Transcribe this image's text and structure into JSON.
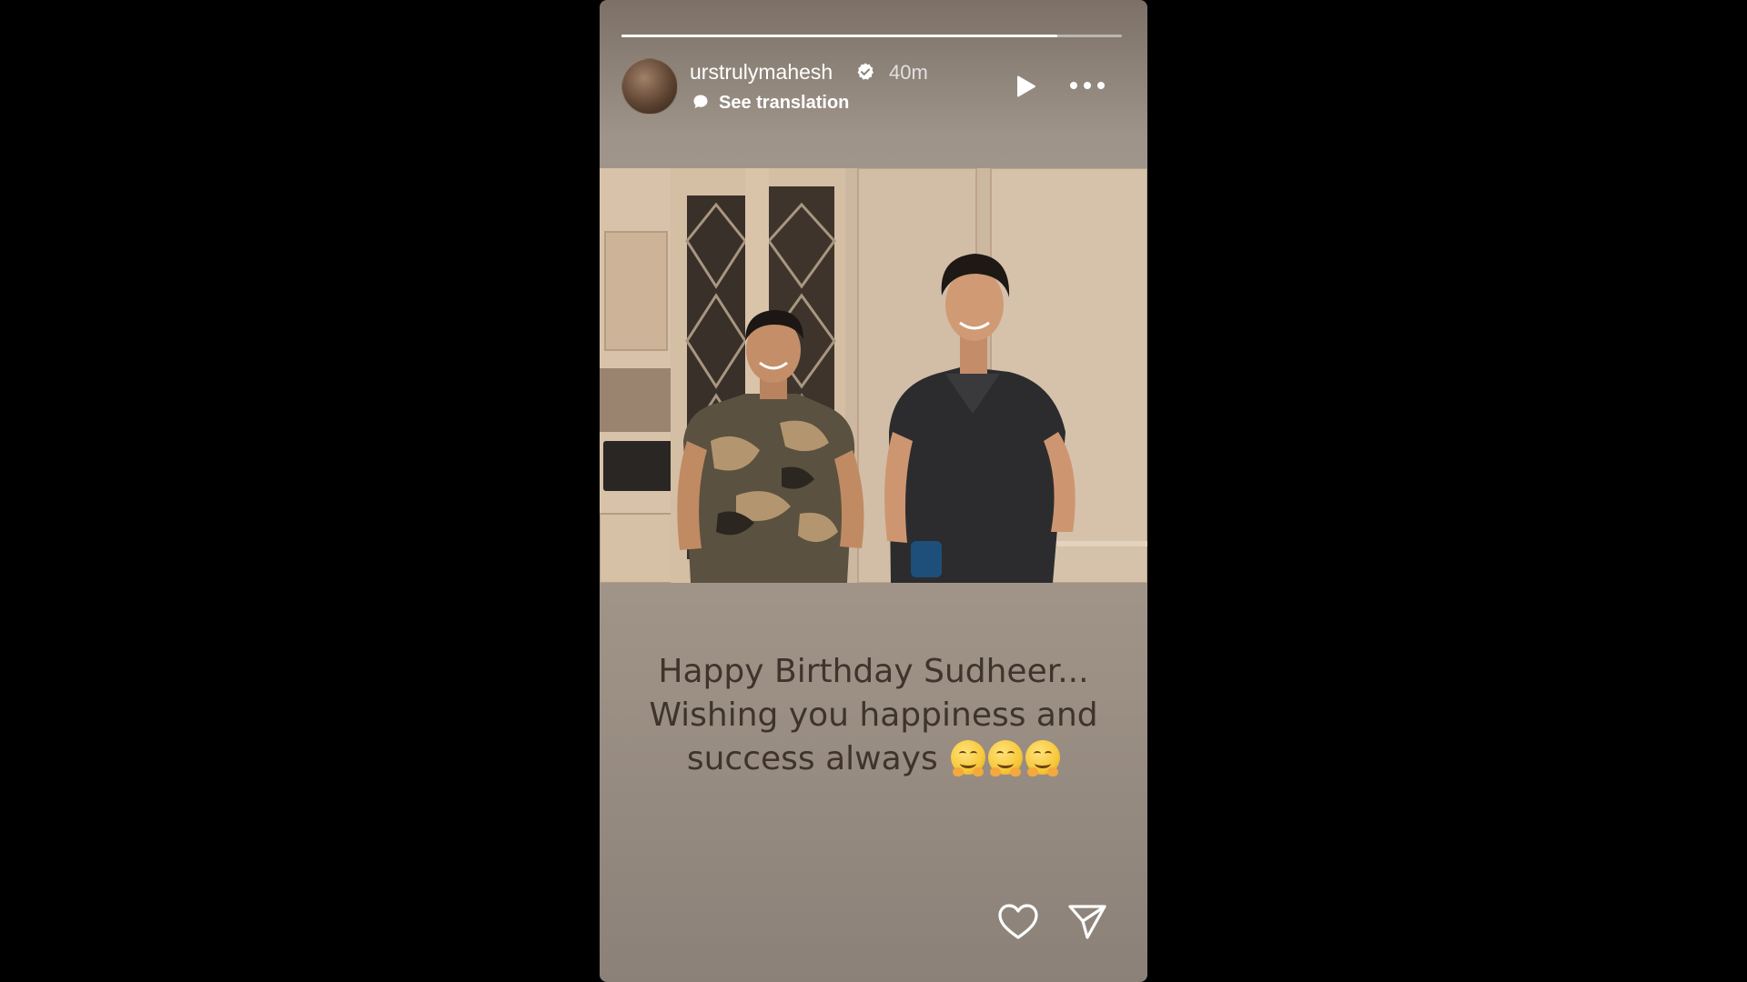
{
  "story": {
    "username": "urstrulymahesh",
    "time_ago": "40m",
    "translation_label": "See translation",
    "progress": 0.87,
    "caption": {
      "line1": "Happy Birthday Sudheer...",
      "line2": "Wishing you happiness and",
      "line3": "success always",
      "emoji_count": 3,
      "emoji_name": "smiling-face-with-open-hands"
    }
  },
  "icons": {
    "avatar": "profile-avatar",
    "verified": "verified-badge-icon",
    "translate": "translate-bubble-icon",
    "play": "play-icon",
    "more": "more-dots-icon",
    "like": "heart-icon",
    "share": "send-icon"
  },
  "colors": {
    "page_background": "#000000",
    "story_background": "#a89c90",
    "caption_text": "#3e342c",
    "header_text": "#ffffff"
  }
}
